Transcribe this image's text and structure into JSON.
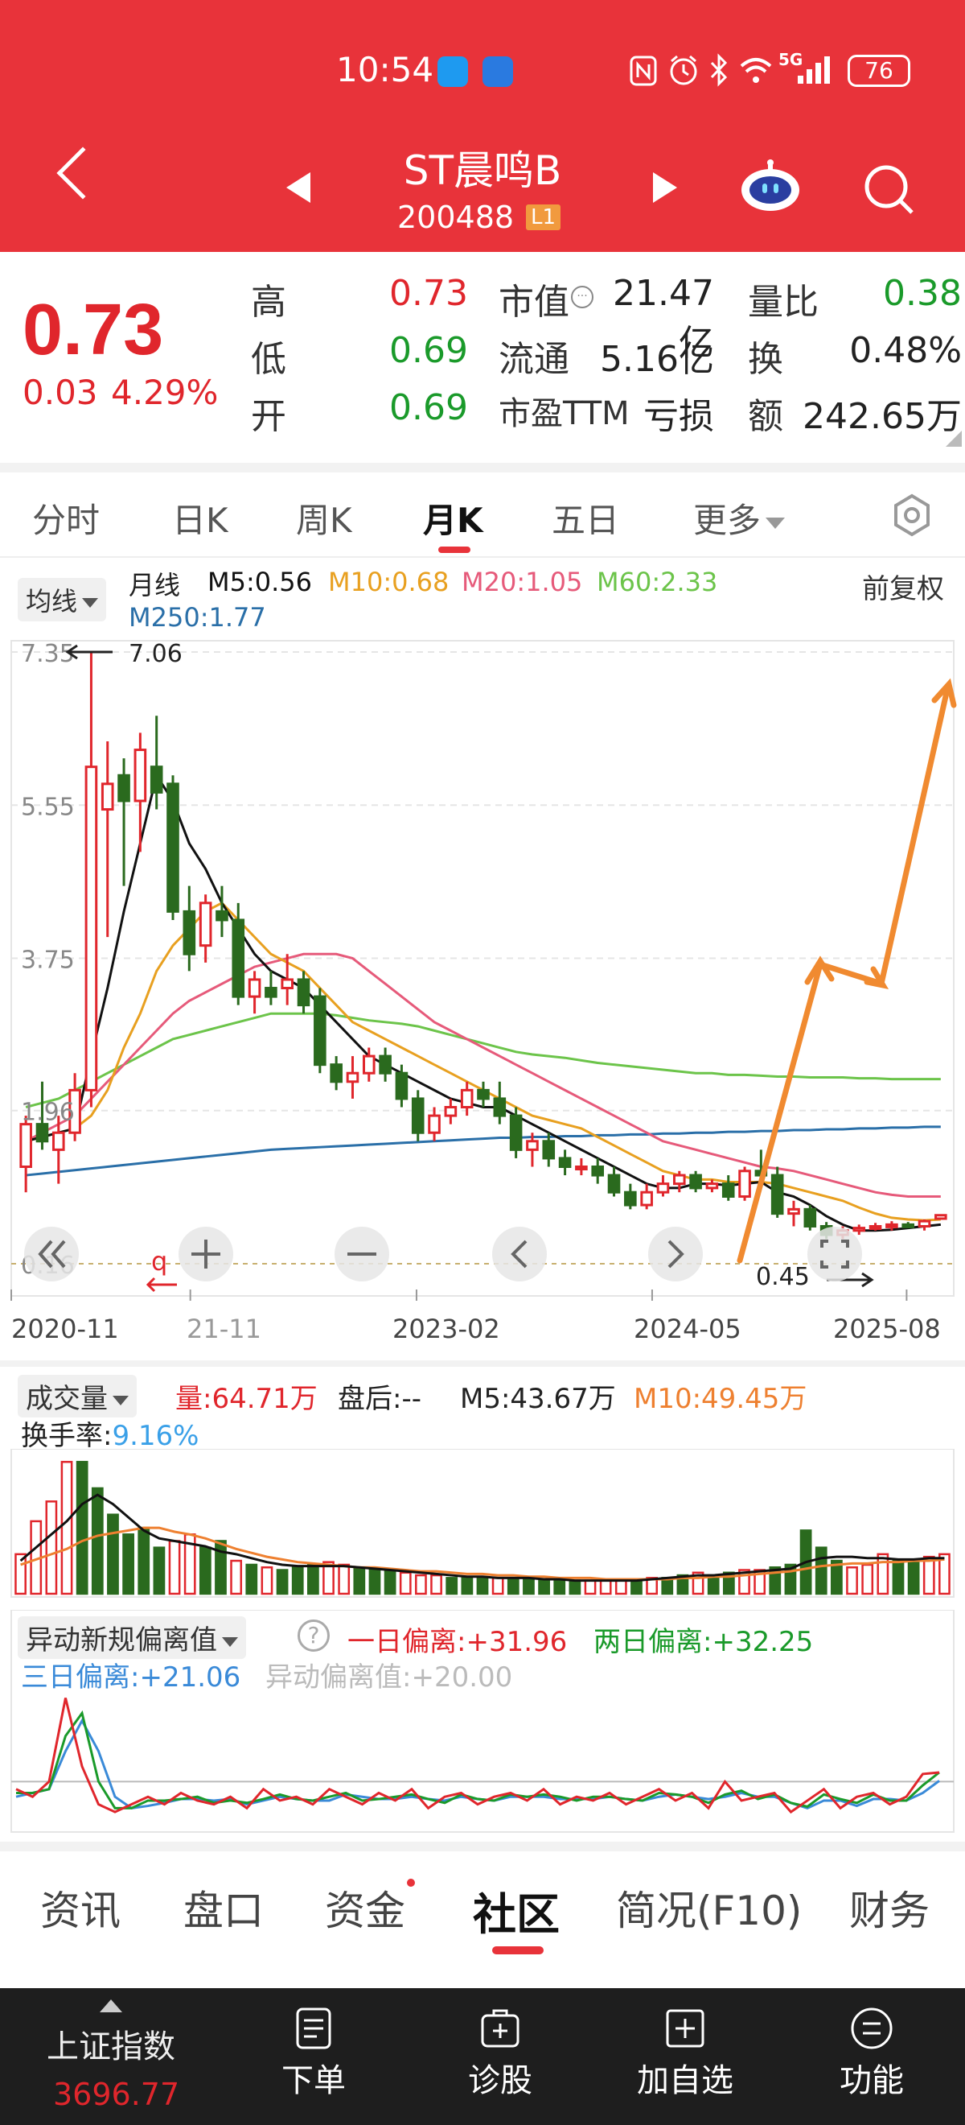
{
  "status_bar": {
    "time": "10:54",
    "network": "5G",
    "battery": "76"
  },
  "header": {
    "stock_name": "ST晨鸣B",
    "stock_code": "200488",
    "level_badge": "L1"
  },
  "quote": {
    "price": "0.73",
    "change": "0.03",
    "change_pct": "4.29%",
    "high_label": "高",
    "high": "0.73",
    "low_label": "低",
    "low": "0.69",
    "open_label": "开",
    "open": "0.69",
    "mcap_label": "市值",
    "mcap": "21.47亿",
    "float_label": "流通",
    "float": "5.16亿",
    "pe_label": "市盈TTM",
    "pe": "亏损",
    "vol_ratio_label": "量比",
    "vol_ratio": "0.38",
    "turnover_label": "换",
    "turnover": "0.48%",
    "amount_label": "额",
    "amount": "242.65万"
  },
  "tabs": [
    {
      "label": "分时"
    },
    {
      "label": "日K"
    },
    {
      "label": "周K"
    },
    {
      "label": "月K"
    },
    {
      "label": "五日"
    },
    {
      "label": "更多"
    }
  ],
  "ma_legend": {
    "selector": "均线",
    "period": "月线",
    "m5": "M5:0.56",
    "m10": "M10:0.68",
    "m20": "M20:1.05",
    "m60": "M60:2.33",
    "m250": "M250:1.77",
    "adjust": "前复权"
  },
  "chart_data": [
    {
      "type": "candlestick",
      "y_ticks": [
        "7.35",
        "5.55",
        "3.75",
        "1.96",
        "0.16"
      ],
      "x_labels": [
        "2020-11",
        "21-11",
        "2023-02",
        "2024-05",
        "2025-08"
      ],
      "max_label": "7.06",
      "min_label": "0.45",
      "ylim": [
        0.16,
        7.35
      ],
      "colors": {
        "up": "#e0262c",
        "down": "#2a6a1e",
        "m5": "#111111",
        "m10": "#e8a020",
        "m20": "#e65a7a",
        "m60": "#6cc44a",
        "m250": "#2a6fa8"
      },
      "candles": [
        {
          "o": 1.3,
          "h": 1.9,
          "l": 1.0,
          "c": 1.8
        },
        {
          "o": 1.8,
          "h": 2.3,
          "l": 1.5,
          "c": 1.6
        },
        {
          "o": 1.5,
          "h": 1.9,
          "l": 1.1,
          "c": 1.7
        },
        {
          "o": 1.7,
          "h": 2.4,
          "l": 1.6,
          "c": 2.2
        },
        {
          "o": 2.2,
          "h": 7.35,
          "l": 2.0,
          "c": 6.0
        },
        {
          "o": 5.5,
          "h": 6.3,
          "l": 4.0,
          "c": 5.8
        },
        {
          "o": 5.9,
          "h": 6.1,
          "l": 4.6,
          "c": 5.6
        },
        {
          "o": 5.6,
          "h": 6.4,
          "l": 5.0,
          "c": 6.2
        },
        {
          "o": 6.0,
          "h": 6.6,
          "l": 5.5,
          "c": 5.7
        },
        {
          "o": 5.8,
          "h": 5.9,
          "l": 4.2,
          "c": 4.3
        },
        {
          "o": 4.3,
          "h": 4.6,
          "l": 3.6,
          "c": 3.8
        },
        {
          "o": 3.9,
          "h": 4.5,
          "l": 3.7,
          "c": 4.4
        },
        {
          "o": 4.3,
          "h": 4.6,
          "l": 4.0,
          "c": 4.2
        },
        {
          "o": 4.2,
          "h": 4.4,
          "l": 3.2,
          "c": 3.3
        },
        {
          "o": 3.3,
          "h": 3.6,
          "l": 3.1,
          "c": 3.5
        },
        {
          "o": 3.4,
          "h": 3.6,
          "l": 3.2,
          "c": 3.3
        },
        {
          "o": 3.4,
          "h": 3.8,
          "l": 3.2,
          "c": 3.5
        },
        {
          "o": 3.5,
          "h": 3.6,
          "l": 3.1,
          "c": 3.2
        },
        {
          "o": 3.3,
          "h": 3.4,
          "l": 2.4,
          "c": 2.5
        },
        {
          "o": 2.5,
          "h": 2.6,
          "l": 2.2,
          "c": 2.3
        },
        {
          "o": 2.3,
          "h": 2.6,
          "l": 2.1,
          "c": 2.4
        },
        {
          "o": 2.4,
          "h": 2.7,
          "l": 2.3,
          "c": 2.6
        },
        {
          "o": 2.6,
          "h": 2.7,
          "l": 2.3,
          "c": 2.4
        },
        {
          "o": 2.4,
          "h": 2.5,
          "l": 2.0,
          "c": 2.1
        },
        {
          "o": 2.1,
          "h": 2.2,
          "l": 1.6,
          "c": 1.7
        },
        {
          "o": 1.7,
          "h": 2.0,
          "l": 1.6,
          "c": 1.9
        },
        {
          "o": 1.9,
          "h": 2.1,
          "l": 1.8,
          "c": 2.0
        },
        {
          "o": 2.0,
          "h": 2.3,
          "l": 1.9,
          "c": 2.2
        },
        {
          "o": 2.2,
          "h": 2.3,
          "l": 2.0,
          "c": 2.1
        },
        {
          "o": 2.1,
          "h": 2.3,
          "l": 1.8,
          "c": 1.9
        },
        {
          "o": 1.9,
          "h": 2.0,
          "l": 1.4,
          "c": 1.5
        },
        {
          "o": 1.5,
          "h": 1.7,
          "l": 1.3,
          "c": 1.6
        },
        {
          "o": 1.6,
          "h": 1.7,
          "l": 1.3,
          "c": 1.4
        },
        {
          "o": 1.4,
          "h": 1.5,
          "l": 1.2,
          "c": 1.3
        },
        {
          "o": 1.3,
          "h": 1.4,
          "l": 1.2,
          "c": 1.3
        },
        {
          "o": 1.3,
          "h": 1.4,
          "l": 1.1,
          "c": 1.2
        },
        {
          "o": 1.2,
          "h": 1.3,
          "l": 0.95,
          "c": 1.0
        },
        {
          "o": 1.0,
          "h": 1.1,
          "l": 0.8,
          "c": 0.85
        },
        {
          "o": 0.85,
          "h": 1.1,
          "l": 0.8,
          "c": 1.0
        },
        {
          "o": 1.0,
          "h": 1.2,
          "l": 0.95,
          "c": 1.1
        },
        {
          "o": 1.1,
          "h": 1.25,
          "l": 1.0,
          "c": 1.2
        },
        {
          "o": 1.2,
          "h": 1.25,
          "l": 1.0,
          "c": 1.05
        },
        {
          "o": 1.05,
          "h": 1.15,
          "l": 1.0,
          "c": 1.1
        },
        {
          "o": 1.1,
          "h": 1.2,
          "l": 0.9,
          "c": 0.95
        },
        {
          "o": 0.95,
          "h": 1.3,
          "l": 0.9,
          "c": 1.25
        },
        {
          "o": 1.25,
          "h": 1.5,
          "l": 1.1,
          "c": 1.2
        },
        {
          "o": 1.2,
          "h": 1.3,
          "l": 0.7,
          "c": 0.75
        },
        {
          "o": 0.75,
          "h": 0.9,
          "l": 0.6,
          "c": 0.8
        },
        {
          "o": 0.8,
          "h": 0.85,
          "l": 0.55,
          "c": 0.6
        },
        {
          "o": 0.6,
          "h": 0.65,
          "l": 0.45,
          "c": 0.5
        },
        {
          "o": 0.5,
          "h": 0.6,
          "l": 0.45,
          "c": 0.55
        },
        {
          "o": 0.55,
          "h": 0.62,
          "l": 0.5,
          "c": 0.58
        },
        {
          "o": 0.58,
          "h": 0.64,
          "l": 0.55,
          "c": 0.6
        },
        {
          "o": 0.6,
          "h": 0.66,
          "l": 0.55,
          "c": 0.62
        },
        {
          "o": 0.62,
          "h": 0.65,
          "l": 0.58,
          "c": 0.6
        },
        {
          "o": 0.6,
          "h": 0.68,
          "l": 0.55,
          "c": 0.66
        },
        {
          "o": 0.69,
          "h": 0.73,
          "l": 0.69,
          "c": 0.73
        }
      ],
      "m5": [
        1.6,
        1.65,
        1.7,
        1.75,
        2.6,
        3.4,
        4.3,
        5.1,
        5.9,
        5.6,
        5.1,
        4.8,
        4.4,
        4.1,
        3.8,
        3.6,
        3.5,
        3.4,
        3.2,
        3.0,
        2.8,
        2.6,
        2.5,
        2.4,
        2.3,
        2.2,
        2.1,
        2.05,
        2.0,
        2.0,
        1.9,
        1.8,
        1.7,
        1.6,
        1.5,
        1.4,
        1.3,
        1.2,
        1.1,
        1.05,
        1.05,
        1.1,
        1.1,
        1.08,
        1.1,
        1.12,
        1.0,
        0.95,
        0.85,
        0.72,
        0.62,
        0.55,
        0.55,
        0.56,
        0.58,
        0.6,
        0.62
      ],
      "m10": [
        1.6,
        1.65,
        1.7,
        1.75,
        1.9,
        2.2,
        2.7,
        3.1,
        3.6,
        3.9,
        4.1,
        4.3,
        4.4,
        4.2,
        4.0,
        3.8,
        3.7,
        3.6,
        3.4,
        3.2,
        3.0,
        2.9,
        2.8,
        2.7,
        2.6,
        2.5,
        2.4,
        2.3,
        2.2,
        2.1,
        2.0,
        1.9,
        1.85,
        1.8,
        1.75,
        1.65,
        1.55,
        1.45,
        1.35,
        1.25,
        1.2,
        1.15,
        1.15,
        1.12,
        1.12,
        1.12,
        1.1,
        1.05,
        1.0,
        0.95,
        0.9,
        0.82,
        0.75,
        0.7,
        0.68,
        0.67,
        0.68
      ],
      "m20": [
        1.6,
        1.7,
        1.8,
        1.9,
        2.1,
        2.3,
        2.5,
        2.7,
        2.9,
        3.1,
        3.25,
        3.35,
        3.45,
        3.55,
        3.65,
        3.7,
        3.75,
        3.8,
        3.8,
        3.8,
        3.75,
        3.6,
        3.45,
        3.3,
        3.15,
        3.0,
        2.9,
        2.8,
        2.7,
        2.6,
        2.5,
        2.4,
        2.3,
        2.2,
        2.1,
        2.0,
        1.9,
        1.8,
        1.7,
        1.6,
        1.55,
        1.5,
        1.45,
        1.4,
        1.35,
        1.3,
        1.28,
        1.25,
        1.2,
        1.15,
        1.1,
        1.05,
        1.0,
        0.97,
        0.95,
        0.95,
        0.95
      ],
      "m60": [
        2.0,
        2.05,
        2.1,
        2.2,
        2.3,
        2.4,
        2.5,
        2.6,
        2.7,
        2.8,
        2.85,
        2.9,
        2.95,
        3.0,
        3.05,
        3.1,
        3.1,
        3.1,
        3.1,
        3.08,
        3.05,
        3.02,
        3.0,
        2.98,
        2.95,
        2.9,
        2.85,
        2.8,
        2.75,
        2.7,
        2.65,
        2.62,
        2.6,
        2.58,
        2.55,
        2.52,
        2.5,
        2.48,
        2.46,
        2.44,
        2.42,
        2.4,
        2.4,
        2.38,
        2.38,
        2.37,
        2.36,
        2.36,
        2.35,
        2.35,
        2.35,
        2.34,
        2.34,
        2.33,
        2.33,
        2.33,
        2.33
      ],
      "m250": [
        1.2,
        1.22,
        1.24,
        1.26,
        1.28,
        1.3,
        1.32,
        1.34,
        1.36,
        1.38,
        1.4,
        1.42,
        1.44,
        1.46,
        1.48,
        1.5,
        1.51,
        1.52,
        1.53,
        1.54,
        1.55,
        1.56,
        1.57,
        1.58,
        1.59,
        1.6,
        1.61,
        1.62,
        1.63,
        1.64,
        1.64,
        1.65,
        1.65,
        1.66,
        1.66,
        1.67,
        1.67,
        1.68,
        1.68,
        1.69,
        1.69,
        1.7,
        1.7,
        1.71,
        1.71,
        1.72,
        1.72,
        1.73,
        1.73,
        1.74,
        1.74,
        1.75,
        1.75,
        1.76,
        1.76,
        1.77,
        1.77
      ]
    },
    {
      "type": "bar",
      "name": "成交量",
      "colors": {
        "up": "#e0262c",
        "down": "#2a6a1e",
        "ma5": "#111111",
        "ma10": "#ee8030"
      },
      "values": [
        30,
        55,
        70,
        100,
        100,
        80,
        60,
        45,
        50,
        35,
        40,
        45,
        35,
        40,
        25,
        22,
        20,
        18,
        20,
        22,
        24,
        22,
        20,
        18,
        18,
        16,
        14,
        14,
        12,
        12,
        12,
        12,
        12,
        12,
        10,
        10,
        10,
        10,
        10,
        10,
        10,
        12,
        12,
        14,
        16,
        14,
        16,
        18,
        18,
        20,
        22,
        48,
        35,
        25,
        20,
        22,
        30,
        25,
        25,
        28,
        30
      ],
      "up_flags": [
        1,
        1,
        1,
        1,
        0,
        0,
        0,
        0,
        0,
        0,
        1,
        1,
        0,
        0,
        1,
        0,
        1,
        0,
        0,
        0,
        1,
        1,
        0,
        0,
        0,
        1,
        1,
        1,
        0,
        0,
        0,
        1,
        0,
        0,
        0,
        0,
        0,
        1,
        1,
        1,
        0,
        1,
        0,
        0,
        1,
        0,
        0,
        1,
        1,
        0,
        0,
        0,
        0,
        0,
        1,
        1,
        1,
        0,
        0,
        1,
        1
      ],
      "ma5": [
        25,
        35,
        45,
        55,
        68,
        75,
        68,
        58,
        48,
        42,
        40,
        38,
        36,
        32,
        30,
        27,
        24,
        22,
        21,
        21,
        21,
        21,
        20,
        19,
        18,
        17,
        16,
        15,
        14,
        13,
        13,
        12,
        12,
        12,
        11,
        11,
        10,
        10,
        10,
        10,
        10,
        11,
        12,
        13,
        14,
        14,
        15,
        16,
        17,
        18,
        19,
        24,
        27,
        28,
        28,
        27,
        27,
        26,
        26,
        27,
        27
      ],
      "ma10": [
        22,
        26,
        30,
        34,
        40,
        44,
        46,
        48,
        50,
        50,
        47,
        45,
        42,
        38,
        34,
        31,
        28,
        26,
        24,
        23,
        22,
        21,
        20,
        20,
        19,
        18,
        17,
        17,
        16,
        15,
        15,
        14,
        14,
        13,
        13,
        12,
        12,
        12,
        11,
        11,
        11,
        11,
        11,
        12,
        12,
        13,
        13,
        14,
        15,
        16,
        17,
        19,
        21,
        22,
        23,
        23,
        24,
        24,
        25,
        25,
        26
      ]
    },
    {
      "type": "line",
      "name": "异动新规偏离值",
      "colors": {
        "one_day": "#e0262c",
        "two_day": "#1a9a2a",
        "three_day": "#3a8ad8",
        "threshold": "#bbbbbb"
      },
      "threshold": 20,
      "ylim": [
        -40,
        140
      ],
      "one_day": [
        10,
        0,
        20,
        130,
        40,
        -10,
        -20,
        -10,
        0,
        -10,
        5,
        -5,
        -10,
        0,
        -15,
        10,
        -5,
        0,
        -10,
        10,
        0,
        -10,
        5,
        -5,
        10,
        -15,
        0,
        5,
        -10,
        0,
        5,
        -5,
        10,
        -10,
        0,
        -5,
        5,
        -10,
        0,
        10,
        -5,
        5,
        -15,
        20,
        -5,
        0,
        5,
        -20,
        -5,
        10,
        -15,
        0,
        5,
        -10,
        0,
        30,
        32
      ],
      "two_day": [
        5,
        5,
        10,
        80,
        110,
        20,
        -15,
        -15,
        -5,
        -5,
        -3,
        0,
        -8,
        -5,
        -8,
        -3,
        3,
        -3,
        -5,
        0,
        5,
        -5,
        -3,
        0,
        3,
        -3,
        -8,
        3,
        -3,
        -5,
        3,
        0,
        3,
        0,
        -5,
        0,
        0,
        -3,
        -5,
        5,
        3,
        0,
        -8,
        3,
        8,
        -3,
        3,
        -8,
        -13,
        3,
        -3,
        -8,
        3,
        -5,
        -5,
        15,
        32
      ],
      "three_day": [
        0,
        5,
        10,
        60,
        100,
        60,
        0,
        -15,
        -12,
        -8,
        -3,
        -3,
        -5,
        -3,
        -10,
        -5,
        0,
        -3,
        -5,
        -5,
        3,
        0,
        -3,
        -3,
        0,
        -3,
        -5,
        0,
        -3,
        -5,
        0,
        0,
        0,
        -3,
        -3,
        -3,
        0,
        -3,
        -5,
        0,
        3,
        0,
        -3,
        0,
        5,
        0,
        0,
        -8,
        -15,
        -5,
        -5,
        -12,
        -3,
        -3,
        -5,
        5,
        21
      ]
    }
  ],
  "volume_legend": {
    "selector": "成交量",
    "vol": "量:64.71万",
    "after_hours": "盘后:--",
    "m5": "M5:43.67万",
    "m10": "M10:49.45万",
    "turnover_label": "换手率:",
    "turnover": "9.16%"
  },
  "indicator_legend": {
    "selector": "异动新规偏离值",
    "help": "?",
    "one_day": "一日偏离:+31.96",
    "two_day": "两日偏离:+32.25",
    "three_day": "三日偏离:+21.06",
    "threshold": "异动偏离值:+20.00"
  },
  "info_tabs": [
    {
      "label": "资讯"
    },
    {
      "label": "盘口"
    },
    {
      "label": "资金"
    },
    {
      "label": "社区"
    },
    {
      "label": "简况(F10)"
    },
    {
      "label": "财务"
    }
  ],
  "bottom_nav": {
    "index_name": "上证指数",
    "index_value": "3696.77",
    "items": [
      {
        "label": "下单"
      },
      {
        "label": "诊股"
      },
      {
        "label": "加自选"
      },
      {
        "label": "功能"
      }
    ]
  }
}
